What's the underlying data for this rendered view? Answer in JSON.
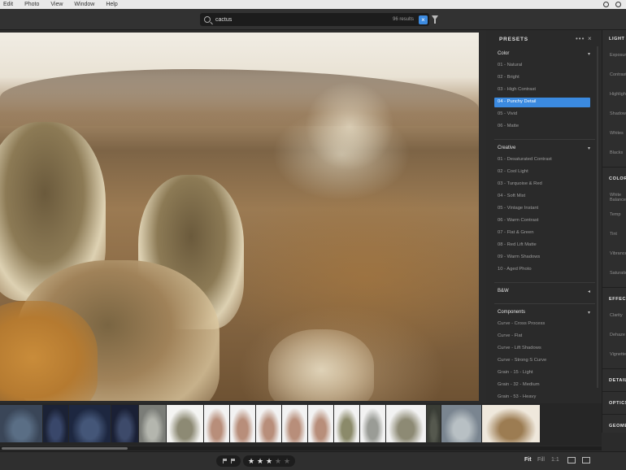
{
  "menubar": {
    "items": [
      "Edit",
      "Photo",
      "View",
      "Window",
      "Help"
    ]
  },
  "search": {
    "query": "cactus",
    "results": "96 results",
    "clear": "×"
  },
  "presets": {
    "title": "PRESETS",
    "more": "•••",
    "close": "×",
    "groups": [
      {
        "name": "Color",
        "chevron": "▾",
        "items": [
          "01 - Natural",
          "02 - Bright",
          "03 - High Contrast",
          "04 - Punchy Detail",
          "05 - Vivid",
          "06 - Matte"
        ],
        "selected": 3
      },
      {
        "name": "Creative",
        "chevron": "▾",
        "items": [
          "01 - Desaturated Contrast",
          "02 - Cool Light",
          "03 - Turquoise & Red",
          "04 - Soft Mist",
          "05 - Vintage Instant",
          "06 - Warm Contrast",
          "07 - Flat & Green",
          "08 - Red Lift Matte",
          "09 - Warm Shadows",
          "10 - Aged Photo"
        ]
      },
      {
        "name": "B&W",
        "chevron": "◂",
        "items": []
      },
      {
        "name": "Components",
        "chevron": "▾",
        "items": [
          "Curve - Cross Process",
          "Curve - Flat",
          "Curve - Lift Shadows",
          "Curve - Strong S Curve",
          "Grain - 15 - Light",
          "Grain - 32 - Medium",
          "Grain - 53 - Heavy"
        ]
      }
    ]
  },
  "edit": {
    "sections": [
      {
        "title": "LIGHT",
        "labels": [
          "Exposure",
          "Contrast",
          "Highlights",
          "Shadows",
          "Whites",
          "Blacks"
        ]
      },
      {
        "title": "COLOR",
        "labels": [
          "White Balance",
          "Temp",
          "Tint",
          "Vibrance",
          "Saturation"
        ]
      },
      {
        "title": "EFFECTS",
        "labels": [
          "Clarity",
          "Dehaze",
          "Vignette"
        ]
      },
      {
        "title": "DETAIL",
        "labels": []
      },
      {
        "title": "OPTICS",
        "labels": []
      },
      {
        "title": "GEOMETRY",
        "labels": []
      }
    ]
  },
  "rating": {
    "stars": 3,
    "max": 5,
    "full": "★",
    "empty": "★"
  },
  "view": {
    "fit": "Fit",
    "fill": "Fill",
    "one": "1:1"
  },
  "colors": {
    "accent": "#3b8ae0",
    "panel": "#2a2a2a",
    "chrome": "#323232"
  }
}
